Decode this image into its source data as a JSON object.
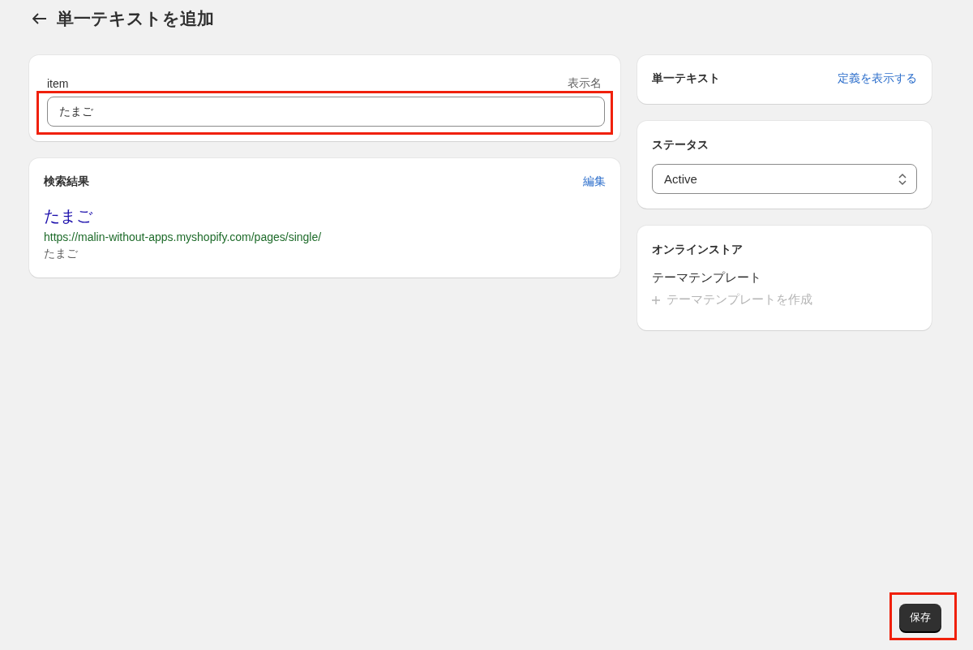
{
  "page": {
    "title": "単一テキストを追加"
  },
  "name_card": {
    "label": "item",
    "hint": "表示名",
    "value": "たまご",
    "highlighted": true
  },
  "seo_card": {
    "title": "検索結果",
    "edit_link": "編集",
    "preview_title": "たまご",
    "preview_url": "https://malin-without-apps.myshopify.com/pages/single/",
    "preview_description": "たまご"
  },
  "definition_card": {
    "title": "単一テキスト",
    "link": "定義を表示する"
  },
  "status_card": {
    "title": "ステータス",
    "value": "Active"
  },
  "store_card": {
    "title": "オンラインストア",
    "label": "テーマテンプレート",
    "action": "テーマテンプレートを作成",
    "action_disabled": true
  },
  "save_button": {
    "label": "保存",
    "highlighted": true
  }
}
